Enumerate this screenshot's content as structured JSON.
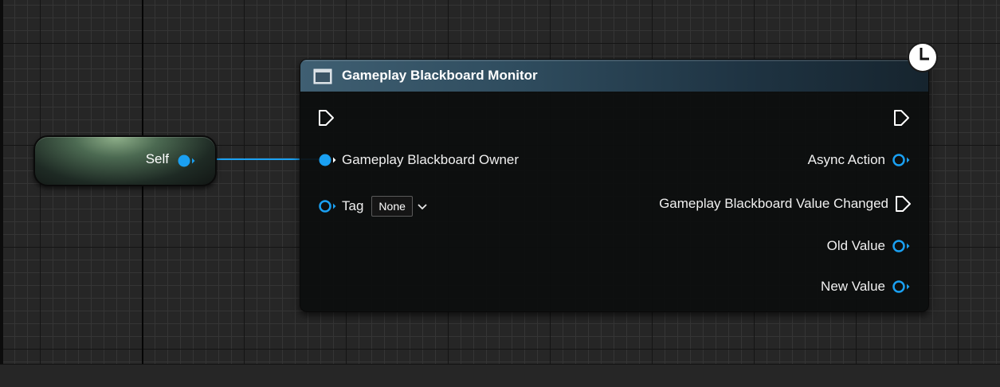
{
  "colors": {
    "pin_object": "#1aa0f2",
    "exec_pin": "#ffffff",
    "wire": "#1aa0f2"
  },
  "self_node": {
    "label": "Self"
  },
  "node": {
    "title": "Gameplay Blackboard Monitor",
    "icon": "function-window-icon",
    "badge_icon": "clock-icon",
    "inputs": {
      "owner_label": "Gameplay Blackboard Owner",
      "tag_label": "Tag",
      "tag_value": "None"
    },
    "outputs": {
      "async_action": "Async Action",
      "value_changed": "Gameplay Blackboard Value Changed",
      "old_value": "Old Value",
      "new_value": "New Value"
    }
  }
}
